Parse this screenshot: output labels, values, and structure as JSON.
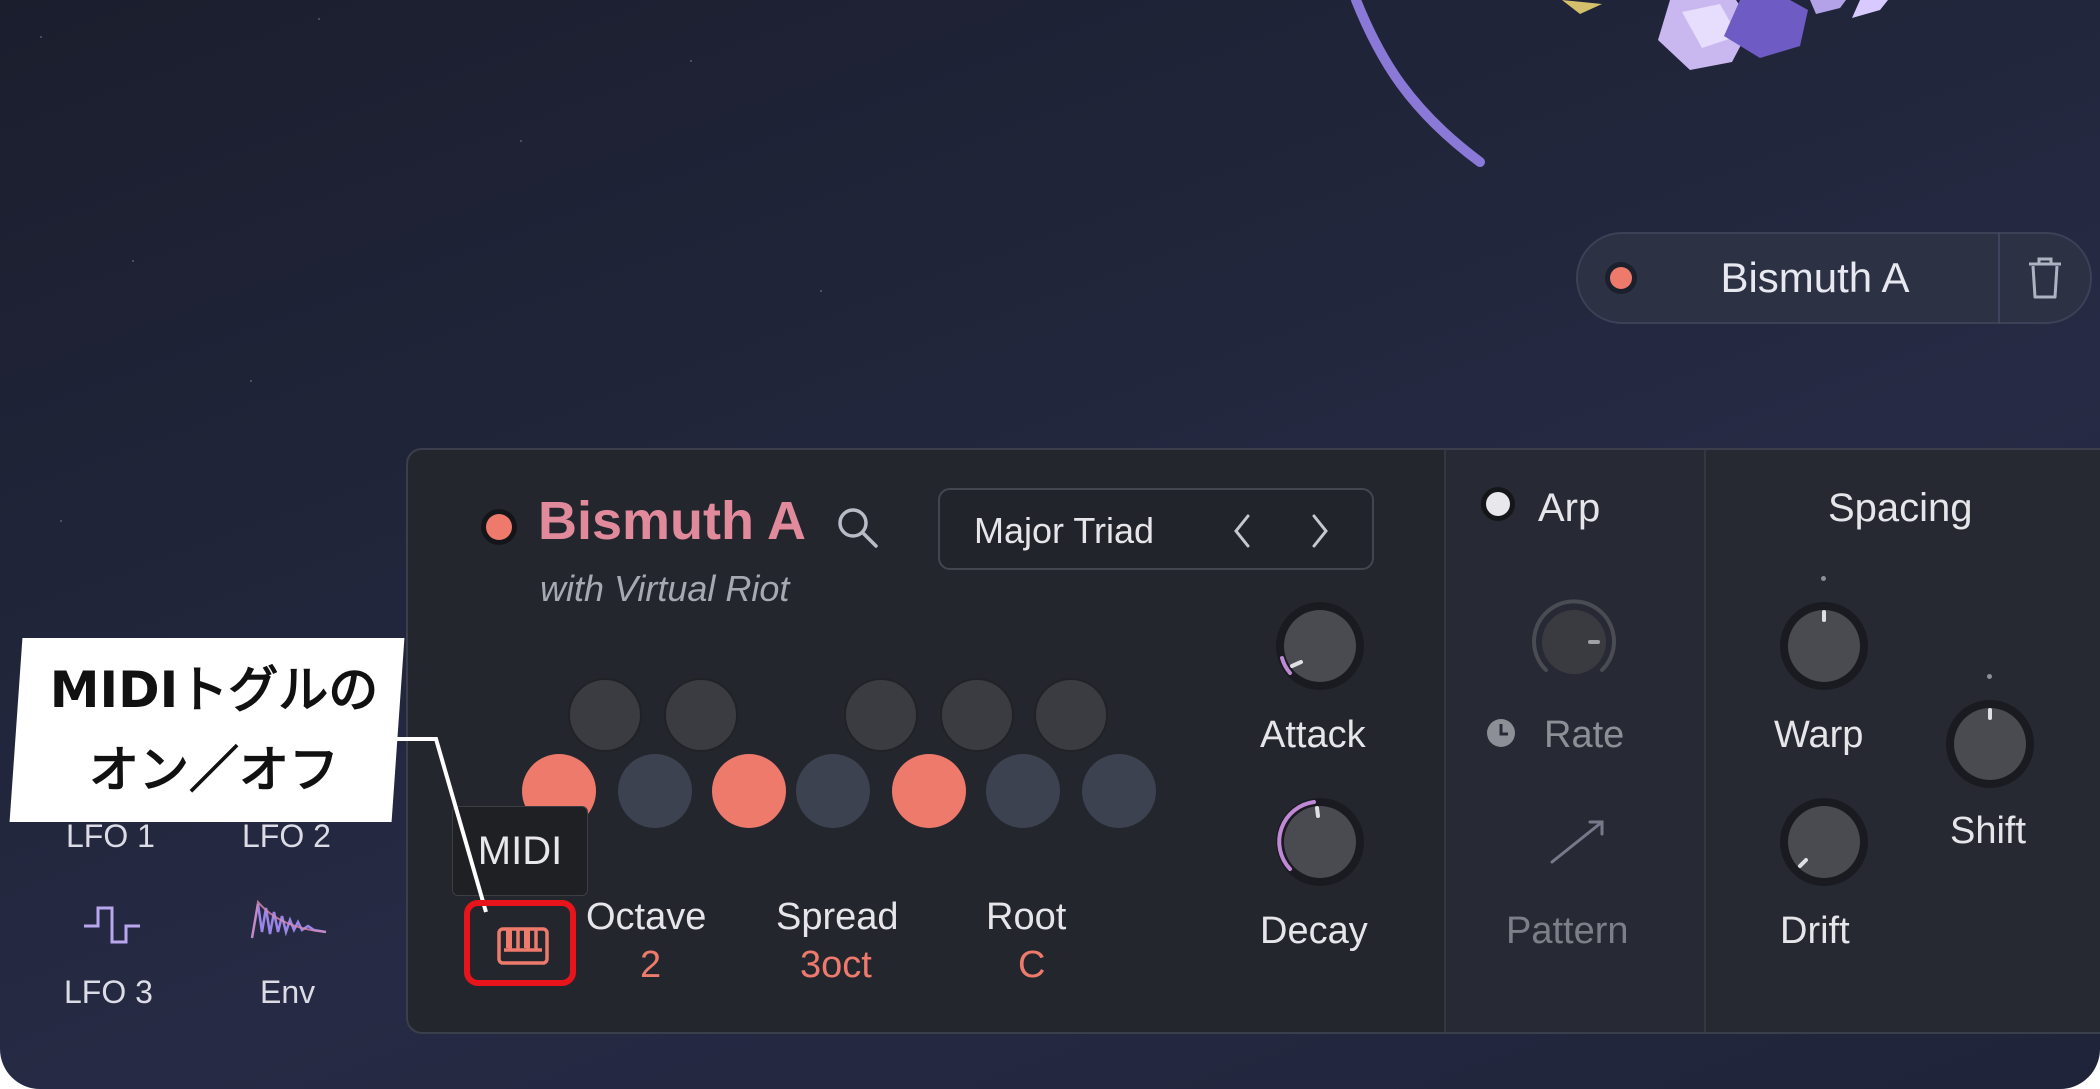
{
  "track_chip": {
    "name": "Bismuth A"
  },
  "instrument": {
    "name": "Bismuth A",
    "subtitle": "with Virtual Riot",
    "chord_preset": "Major Triad"
  },
  "chord_params": [
    {
      "label": "Octave",
      "value": "2"
    },
    {
      "label": "Spread",
      "value": "3oct"
    },
    {
      "label": "Root",
      "value": "C"
    }
  ],
  "envelope": {
    "attack_label": "Attack",
    "decay_label": "Decay"
  },
  "arp": {
    "title": "Arp",
    "rate_label": "Rate",
    "pattern_label": "Pattern"
  },
  "spacing": {
    "title": "Spacing",
    "warp_label": "Warp",
    "drift_label": "Drift",
    "shift_label": "Shift"
  },
  "modulators": [
    {
      "label": "LFO 1"
    },
    {
      "label": "LFO 2"
    },
    {
      "label": "LFO 3",
      "icon": "square-lfo-icon"
    },
    {
      "label": "Env",
      "icon": "envelope-wave-icon"
    }
  ],
  "tooltip": "MIDI",
  "callout": {
    "line1": "MIDIトグルの",
    "line2": "オン／オフ"
  },
  "colors": {
    "accent": "#ee7a6b",
    "title_pink": "#e08a9c",
    "highlight": "#e8141c",
    "lavender": "#9b86e8"
  }
}
